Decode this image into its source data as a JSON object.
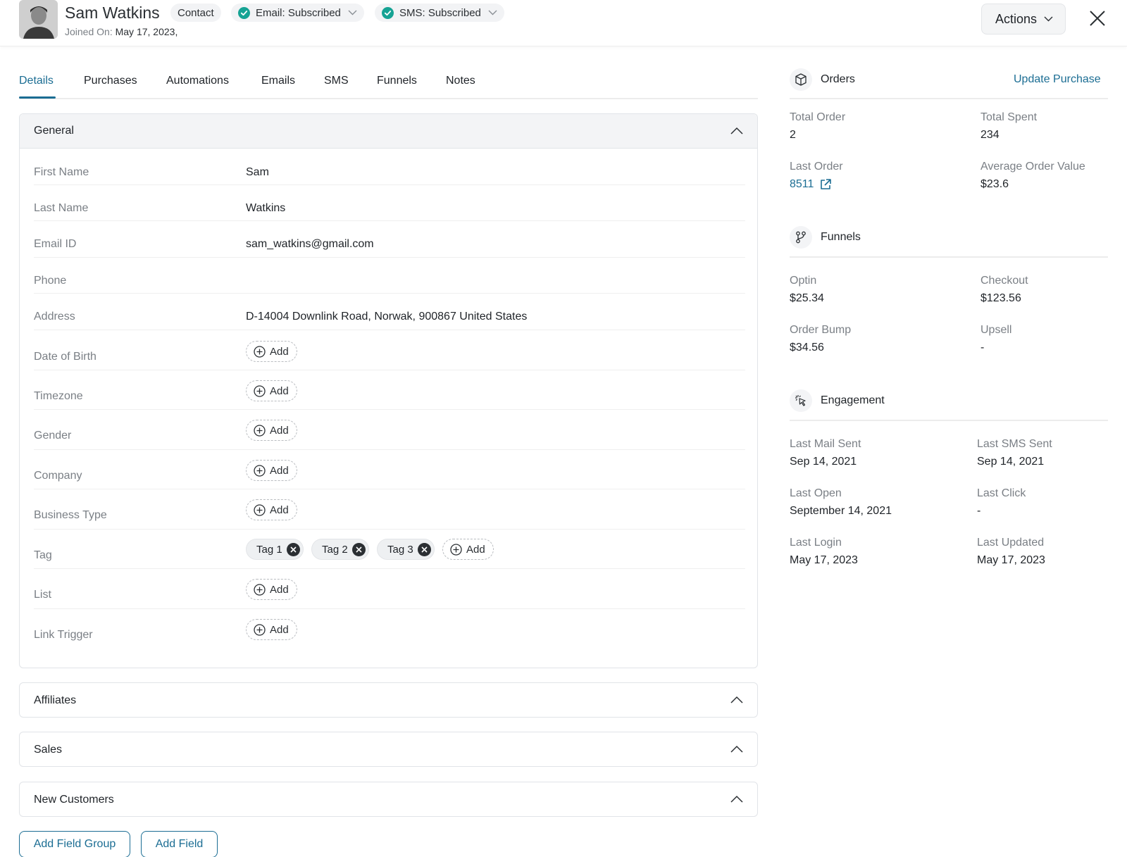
{
  "header": {
    "name": "Sam Watkins",
    "contact_badge": "Contact",
    "joined_label": "Joined On:",
    "joined_value": "May 17, 2023,",
    "email_status": "Email: Subscribed",
    "sms_status": "SMS: Subscribed",
    "actions_label": "Actions"
  },
  "tabs": [
    "Details",
    "Purchases",
    "Automations",
    "Emails",
    "SMS",
    "Funnels",
    "Notes"
  ],
  "general": {
    "title": "General",
    "fields": [
      {
        "label": "First Name",
        "value": "Sam"
      },
      {
        "label": "Last Name",
        "value": "Watkins"
      },
      {
        "label": "Email ID",
        "value": "sam_watkins@gmail.com"
      },
      {
        "label": "Phone",
        "value": ""
      },
      {
        "label": "Address",
        "value": "D-14004  Downlink Road, Norwak, 900867 United States"
      },
      {
        "label": "Date of Birth",
        "add": "Add"
      },
      {
        "label": "Timezone",
        "add": "Add"
      },
      {
        "label": "Gender",
        "add": "Add"
      },
      {
        "label": "Company",
        "add": "Add"
      },
      {
        "label": "Business Type",
        "add": "Add"
      },
      {
        "label": "Tag",
        "tags": [
          "Tag 1",
          "Tag 2",
          "Tag 3"
        ],
        "add": "Add"
      },
      {
        "label": "List",
        "add": "Add"
      },
      {
        "label": "Link Trigger",
        "add": "Add"
      }
    ]
  },
  "collapsed_groups": [
    "Affiliates",
    "Sales",
    "New Customers"
  ],
  "footer": {
    "add_field_group": "Add Field Group",
    "add_field": "Add Field"
  },
  "orders": {
    "title": "Orders",
    "update_link": "Update Purchase",
    "total_order_label": "Total Order",
    "total_order_value": "2",
    "total_spent_label": "Total Spent",
    "total_spent_value": "234",
    "last_order_label": "Last Order",
    "last_order_value": "8511",
    "aov_label": "Average Order Value",
    "aov_value": "$23.6"
  },
  "funnels": {
    "title": "Funnels",
    "optin_label": "Optin",
    "optin_value": "$25.34",
    "checkout_label": "Checkout",
    "checkout_value": "$123.56",
    "bump_label": "Order Bump",
    "bump_value": "$34.56",
    "upsell_label": "Upsell",
    "upsell_value": "-"
  },
  "engagement": {
    "title": "Engagement",
    "mail_label": "Last Mail Sent",
    "mail_value": "Sep 14, 2021",
    "sms_label": "Last SMS Sent",
    "sms_value": "Sep 14, 2021",
    "open_label": "Last Open",
    "open_value": "September 14, 2021",
    "click_label": "Last Click",
    "click_value": "-",
    "login_label": "Last Login",
    "login_value": "May 17, 2023",
    "updated_label": "Last Updated",
    "updated_value": "May 17, 2023"
  },
  "colors": {
    "accent": "#1b6d93",
    "success": "#16a394"
  }
}
